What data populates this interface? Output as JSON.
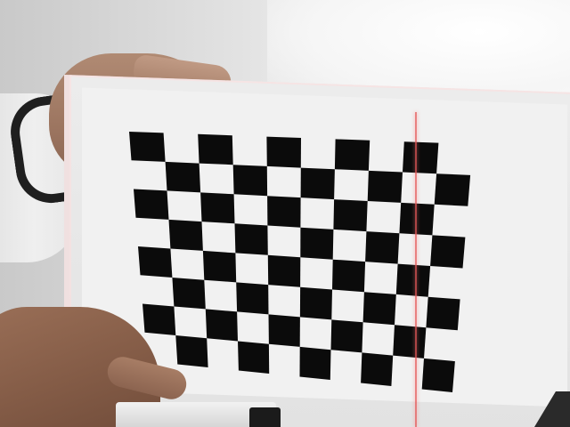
{
  "scene": {
    "description_label": "",
    "checkerboard": {
      "rows": 8,
      "cols": 10,
      "square_color": "#0b0b0b",
      "paper_color": "#f1f1f1"
    },
    "laser_line_color": "#e65a5a",
    "skin_color": "#9c7560",
    "wristband_color": "#1f1f1f"
  }
}
